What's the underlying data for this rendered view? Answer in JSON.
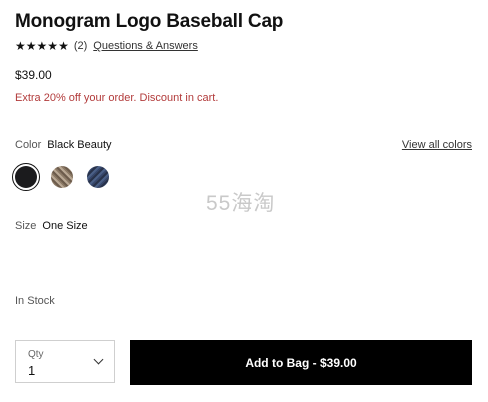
{
  "product": {
    "title": "Monogram Logo Baseball Cap",
    "rating_count": "(2)",
    "qa_link": "Questions & Answers",
    "price": "$39.00",
    "promo": "Extra 20% off your order. Discount in cart."
  },
  "rating": {
    "stars": 5,
    "max": 5,
    "star_glyph": "★"
  },
  "color": {
    "label": "Color",
    "selected": "Black Beauty",
    "view_all": "View all colors",
    "swatches": [
      {
        "name": "black-beauty",
        "color": "#1b1b1d",
        "selected": true
      },
      {
        "name": "tan-monogram",
        "color": "#8c7a66",
        "selected": false
      },
      {
        "name": "navy-monogram",
        "color": "#36466a",
        "selected": false
      }
    ]
  },
  "watermark": "55海淘",
  "size": {
    "label": "Size",
    "value": "One Size"
  },
  "stock": "In Stock",
  "quantity": {
    "label": "Qty",
    "value": "1"
  },
  "cta": {
    "label": "Add to Bag - $39.00"
  }
}
